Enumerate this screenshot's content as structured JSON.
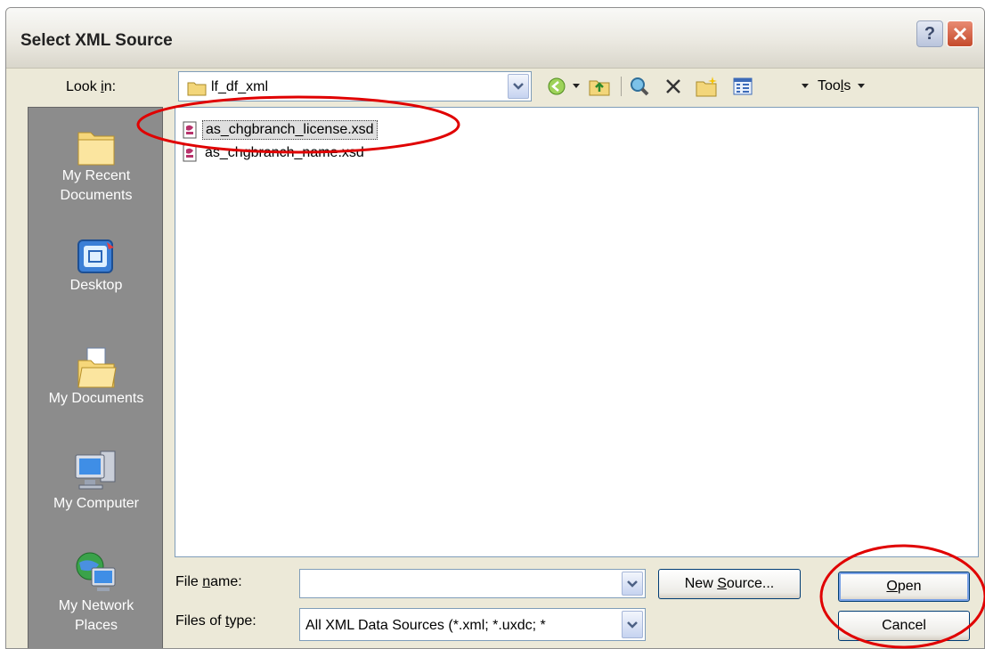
{
  "window": {
    "title": "Select XML Source",
    "help_label": "?"
  },
  "lookin": {
    "label": "Look in:",
    "value": "lf_df_xml"
  },
  "toolbar": {
    "tools_label": "Tools"
  },
  "places": [
    {
      "label1": "My Recent",
      "label2": "Documents",
      "icon": "recent-documents-icon"
    },
    {
      "label1": "Desktop",
      "label2": "",
      "icon": "desktop-icon"
    },
    {
      "label1": "My Documents",
      "label2": "",
      "icon": "my-documents-icon"
    },
    {
      "label1": "My Computer",
      "label2": "",
      "icon": "my-computer-icon"
    },
    {
      "label1": "My Network",
      "label2": "Places",
      "icon": "network-places-icon"
    }
  ],
  "files": [
    {
      "name": "as_chgbranch_license.xsd",
      "selected": true
    },
    {
      "name": "as_chgbranch_name.xsd",
      "selected": false
    }
  ],
  "filename": {
    "label": "File name:",
    "value": ""
  },
  "filetype": {
    "label": "Files of type:",
    "value": "All XML Data Sources (*.xml; *.uxdc; *"
  },
  "buttons": {
    "new_source": "New Source...",
    "open": "Open",
    "cancel": "Cancel"
  },
  "colors": {
    "annotation": "#e00000"
  }
}
